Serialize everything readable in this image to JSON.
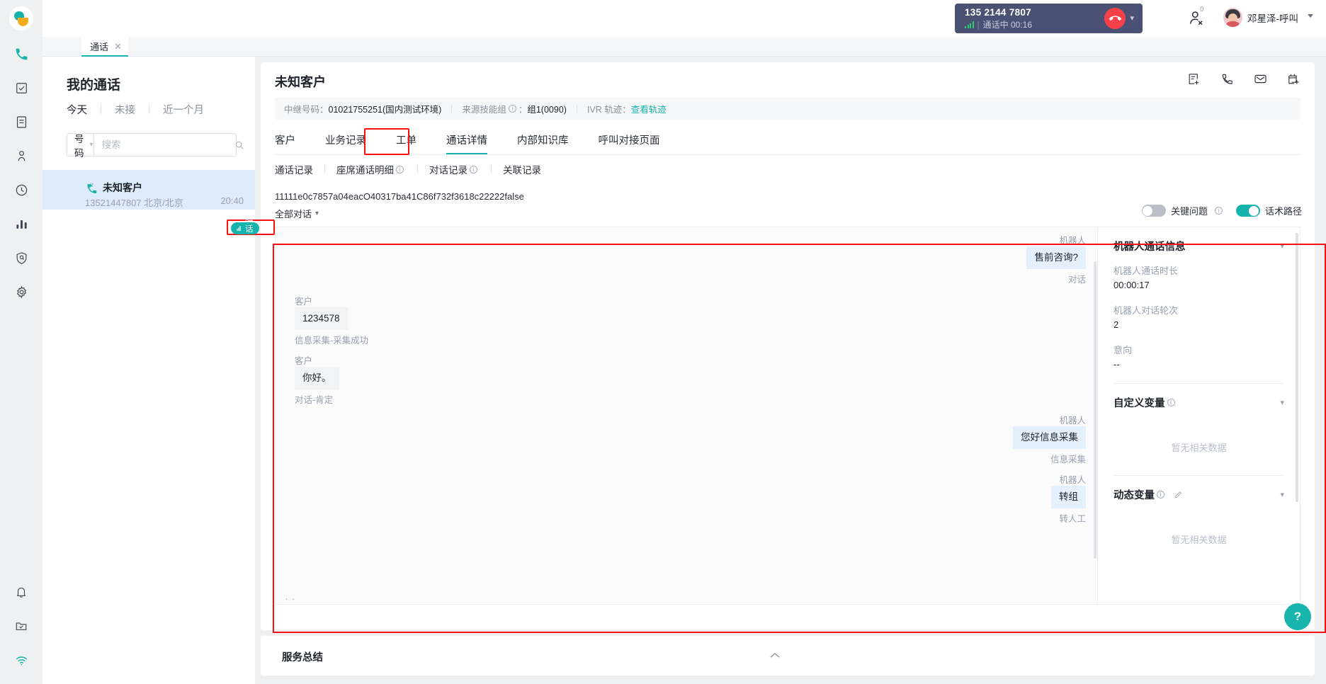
{
  "topbar": {
    "logo_icon": "app-logo",
    "call": {
      "number": "135 2144 7807",
      "signal_icon": "signal-bars-icon",
      "separator": "|",
      "state": "通话中 00:16",
      "hangup_icon": "hangup-phone-icon",
      "caret_icon": "chevron-down-icon"
    },
    "people_icon": "people-icon",
    "people_badge": "0",
    "avatar_icon": "user-avatar",
    "user_name": "邓星泽-呼叫",
    "user_caret_icon": "caret-down-icon"
  },
  "rail": {
    "items": [
      {
        "icon": "phone-icon",
        "active": true
      },
      {
        "icon": "checkbox-task-icon"
      },
      {
        "icon": "document-icon"
      },
      {
        "icon": "contact-person-icon"
      },
      {
        "icon": "clock-history-icon"
      },
      {
        "icon": "bar-chart-icon"
      },
      {
        "icon": "shield-search-icon"
      },
      {
        "icon": "gear-settings-icon"
      }
    ],
    "bottom_items": [
      {
        "icon": "bell-notification-icon"
      },
      {
        "icon": "folder-check-icon"
      },
      {
        "icon": "wifi-signal-icon"
      }
    ]
  },
  "tabstrip": {
    "tabs": [
      {
        "label": "通话",
        "close_icon": "close-icon"
      }
    ]
  },
  "list_panel": {
    "title": "我的通话",
    "filters": [
      "今天",
      "未接",
      "近一个月"
    ],
    "search": {
      "select_value": "号码",
      "select_caret_icon": "chevron-down-icon",
      "placeholder": "搜索",
      "input_value": "",
      "search_icon": "search-icon"
    },
    "items": [
      {
        "call_icon": "incoming-call-icon",
        "name": "未知客户",
        "meta": "13521447807 北京/北京",
        "time": "20:40",
        "badge": {
          "icon": "wave-icon",
          "label": "通话中",
          "color": "#16b3ac"
        }
      }
    ]
  },
  "main": {
    "customer_title": "未知客户",
    "head_icons": [
      "add-record-icon",
      "phone-call-icon",
      "mail-envelope-icon",
      "add-calendar-icon"
    ],
    "info_bar": {
      "trunk_label": "中继号码：",
      "trunk_value": "01021755251(国内测试环境)",
      "skill_label": "来源技能组",
      "skill_info_icon": "info-icon",
      "skill_colon": "：",
      "skill_value": "组1(0090)",
      "ivr_label": "IVR 轨迹：",
      "ivr_link": "查看轨迹"
    },
    "tabs": [
      {
        "label": "客户",
        "active": false
      },
      {
        "label": "业务记录",
        "active": false
      },
      {
        "label": "工单",
        "active": false
      },
      {
        "label": "通话详情",
        "active": true,
        "highlighted": true
      },
      {
        "label": "内部知识库",
        "active": false
      },
      {
        "label": "呼叫对接页面",
        "active": false
      }
    ],
    "subtabs": [
      {
        "label": "通话记录",
        "info_icon": false
      },
      {
        "label": "座席通话明细",
        "info_icon": true
      },
      {
        "label": "对话记录",
        "info_icon": true
      },
      {
        "label": "关联记录",
        "info_icon": false
      }
    ],
    "session_id": "11111e0c7857a04eacO40317ba41C86f732f3618c22222false",
    "dialog_select": {
      "label": "全部对话",
      "caret_icon": "chevron-down-icon"
    },
    "toggles": [
      {
        "label": "关键问题",
        "state": "off",
        "info_icon": true
      },
      {
        "label": "话术路径",
        "state": "on",
        "info_icon": false
      }
    ],
    "conversation": [
      {
        "side": "bot",
        "who": "机器人",
        "text": "售前咨询?",
        "tag": "对话"
      },
      {
        "side": "cust",
        "who": "客户",
        "text": "1234578",
        "tag": "信息采集-采集成功"
      },
      {
        "side": "cust",
        "who": "客户",
        "text": "你好。",
        "tag": "对话-肯定"
      },
      {
        "side": "bot",
        "who": "机器人",
        "text": "您好信息采集",
        "tag": "信息采集"
      },
      {
        "side": "bot",
        "who": "机器人",
        "text": "转组",
        "tag": "转人工"
      }
    ],
    "right_panel": {
      "sections": [
        {
          "title": "机器人通话信息",
          "info_icon": false,
          "edit_icon": false,
          "collapse_icon": "chevron-down-icon",
          "fields": [
            {
              "key": "机器人通话时长",
              "value": "00:00:17"
            },
            {
              "key": "机器人对话轮次",
              "value": "2"
            },
            {
              "key": "意向",
              "value": "--"
            }
          ]
        },
        {
          "title": "自定义变量",
          "info_icon": true,
          "edit_icon": false,
          "collapse_icon": "chevron-down-icon",
          "empty_text": "暂无相关数据"
        },
        {
          "title": "动态变量",
          "info_icon": true,
          "edit_icon": true,
          "collapse_icon": "chevron-down-icon",
          "empty_text": "暂无相关数据"
        }
      ]
    }
  },
  "summary": {
    "title": "服务总结",
    "collapse_icon": "chevron-up-icon"
  },
  "help": {
    "icon": "help-question-icon",
    "label": "?"
  },
  "annotations": {
    "highlight_color": "#fb0f0f",
    "accent_color": "#16b3ac",
    "boxes": [
      "status-badge",
      "tab-通话详情",
      "conversation-area"
    ]
  }
}
